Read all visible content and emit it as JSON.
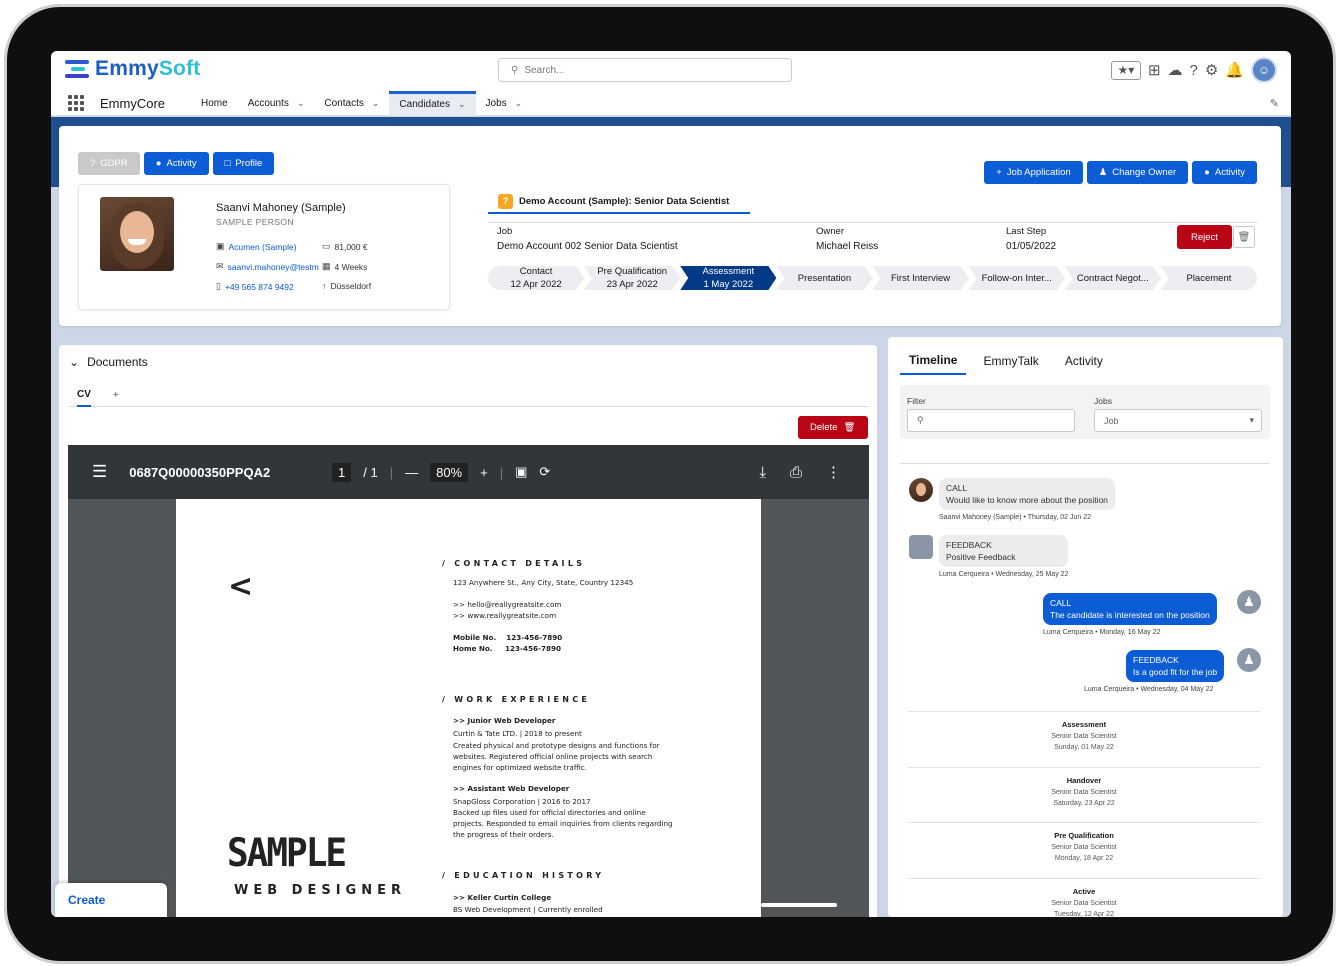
{
  "app": {
    "logo_first": "Emmy",
    "logo_second": "Soft",
    "search_placeholder": "Search...",
    "app_name": "EmmyCore"
  },
  "nav": [
    {
      "label": "Home",
      "dropdown": false
    },
    {
      "label": "Accounts",
      "dropdown": true
    },
    {
      "label": "Contacts",
      "dropdown": true
    },
    {
      "label": "Candidates",
      "dropdown": true,
      "active": true
    },
    {
      "label": "Jobs",
      "dropdown": true
    }
  ],
  "record": {
    "left_buttons": {
      "gdpr": "GDPR",
      "activity": "Activity",
      "profile": "Profile"
    },
    "right_buttons": {
      "job_application": "Job Application",
      "change_owner": "Change Owner",
      "activity": "Activity"
    },
    "person": {
      "name": "Saanvi Mahoney (Sample)",
      "type": "SAMPLE PERSON",
      "company": "Acumen (Sample)",
      "salary": "81,000 €",
      "email": "saanvi.mahoney@testm",
      "notice": "4 Weeks",
      "phone": "+49 565 874 9492",
      "city": "Düsseldorf"
    },
    "job": {
      "title": "Demo Account (Sample): Senior Data Scientist",
      "job_label": "Job",
      "job_value": "Demo Account 002 Senior Data Scientist",
      "owner_label": "Owner",
      "owner_value": "Michael Reiss",
      "last_step_label": "Last Step",
      "last_step_value": "01/05/2022",
      "reject": "Reject"
    },
    "steps": [
      {
        "label": "Contact",
        "date": "12 Apr 2022"
      },
      {
        "label": "Pre Qualification",
        "date": "23 Apr 2022"
      },
      {
        "label": "Assessment",
        "date": "1 May 2022",
        "current": true
      },
      {
        "label": "Presentation",
        "date": ""
      },
      {
        "label": "First Interview",
        "date": ""
      },
      {
        "label": "Follow-on Inter...",
        "date": ""
      },
      {
        "label": "Contract Negot...",
        "date": ""
      },
      {
        "label": "Placement",
        "date": ""
      }
    ]
  },
  "documents": {
    "title": "Documents",
    "tab_cv": "CV",
    "tab_add": "+",
    "delete": "Delete",
    "viewer": {
      "file": "0687Q00000350PPQA2",
      "page": "1",
      "pages": "/ 1",
      "zoom": "80%"
    },
    "cv": {
      "chevron": "<",
      "contact_hd": "/ CONTACT DETAILS",
      "address": "123 Anywhere St., Any City, State, Country 12345",
      "email": ">> hello@reallygreatsite.com",
      "web": ">> www.reallygreatsite.com",
      "mobile": "Mobile No.    123-456-7890",
      "home": "Home No.     123-456-7890",
      "work_hd": "/ WORK EXPERIENCE",
      "job1": ">> Junior Web Developer",
      "job1_co": "Curtin & Tate LTD. | 2018 to present",
      "job1_d1": "Created physical and prototype designs and functions for",
      "job1_d2": "websites. Registered official online projects with search",
      "job1_d3": "engines for optimized website traffic.",
      "job2": ">> Assistant Web Developer",
      "job2_co": "SnapGloss Corporation | 2016 to 2017",
      "job2_d1": "Backed up files used for official directories and online",
      "job2_d2": "projects. Responded to email inquiries from clients regarding",
      "job2_d3": "the progress of their orders.",
      "edu_hd": "/ EDUCATION HISTORY",
      "edu1": ">> Keller Curtin College",
      "edu1_d": "BS Web Development | Currently enrolled",
      "sample": "SAMPLE",
      "role": "WEB DESIGNER"
    }
  },
  "create": "Create",
  "timeline": {
    "tabs": [
      "Timeline",
      "EmmyTalk",
      "Activity"
    ],
    "filter_label": "Filter",
    "jobs_label": "Jobs",
    "jobs_value": "Job",
    "messages": [
      {
        "type": "CALL",
        "text": "Would like to know more about the position",
        "meta": "Saanvi Mahoney (Sample) • Thursday, 02 Jun 22"
      },
      {
        "type": "FEEDBACK",
        "text": "Positive Feedback",
        "meta": "Luma Cerqueira • Wednesday, 25 May 22"
      },
      {
        "type": "CALL",
        "text": "The candidate is interested on the position",
        "meta": "Luma Cerqueira • Monday, 16 May 22"
      },
      {
        "type": "FEEDBACK",
        "text": "Is a good fit for the job",
        "meta": "Luma Cerqueira • Wednesday, 04 May 22"
      }
    ],
    "events": [
      {
        "title": "Assessment",
        "job": "Senior Data Scientist",
        "date": "Sunday, 01 May 22"
      },
      {
        "title": "Handover",
        "job": "Senior Data Scientist",
        "date": "Saturday, 23 Apr 22"
      },
      {
        "title": "Pre Qualification",
        "job": "Senior Data Scientist",
        "date": "Monday, 18 Apr 22"
      },
      {
        "title": "Active",
        "job": "Senior Data Scientist",
        "date": "Tuesday, 12 Apr 22"
      }
    ]
  },
  "colors": {
    "brand": "#0b5cd5",
    "reject": "#ba0517",
    "current_step": "#023a86"
  }
}
